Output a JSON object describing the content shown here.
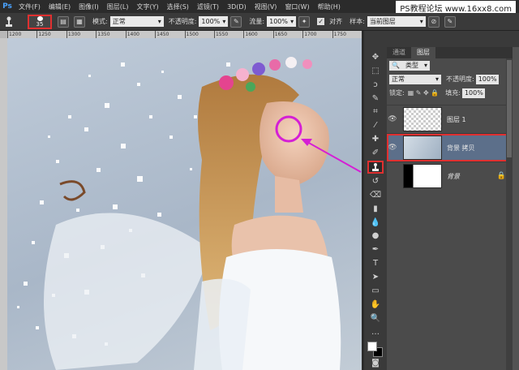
{
  "app_logo": "Ps",
  "watermark": "PS教程论坛 www.16xx8.com",
  "menu": [
    "文件(F)",
    "编辑(E)",
    "图像(I)",
    "图层(L)",
    "文字(Y)",
    "选择(S)",
    "滤镜(T)",
    "3D(D)",
    "视图(V)",
    "窗口(W)",
    "帮助(H)"
  ],
  "options": {
    "brush_size": "35",
    "mode_label": "模式:",
    "mode_value": "正常",
    "opacity_label": "不透明度:",
    "opacity_value": "100%",
    "flow_label": "流量:",
    "flow_value": "100%",
    "align_label": "对齐",
    "sample_label": "样本:",
    "sample_value": "当前图层"
  },
  "ruler_ticks": [
    "1200",
    "1250",
    "1300",
    "1350",
    "1400",
    "1450",
    "1500",
    "1550",
    "1600",
    "1650",
    "1700",
    "1750"
  ],
  "panel": {
    "tabs": [
      "通道",
      "图层"
    ],
    "filter_value": "类型",
    "blend_mode": "正常",
    "opacity_label": "不透明度:",
    "opacity_value": "100%",
    "lock_label": "锁定:",
    "fill_label": "填充:",
    "fill_value": "100%",
    "layers": [
      {
        "name": "图层 1"
      },
      {
        "name": "背景 拷贝"
      },
      {
        "name": "背景"
      }
    ]
  },
  "colors": {
    "highlight_red": "#e03030",
    "arrow_magenta": "#d51fd5",
    "selected_layer": "#5c6f8a"
  }
}
